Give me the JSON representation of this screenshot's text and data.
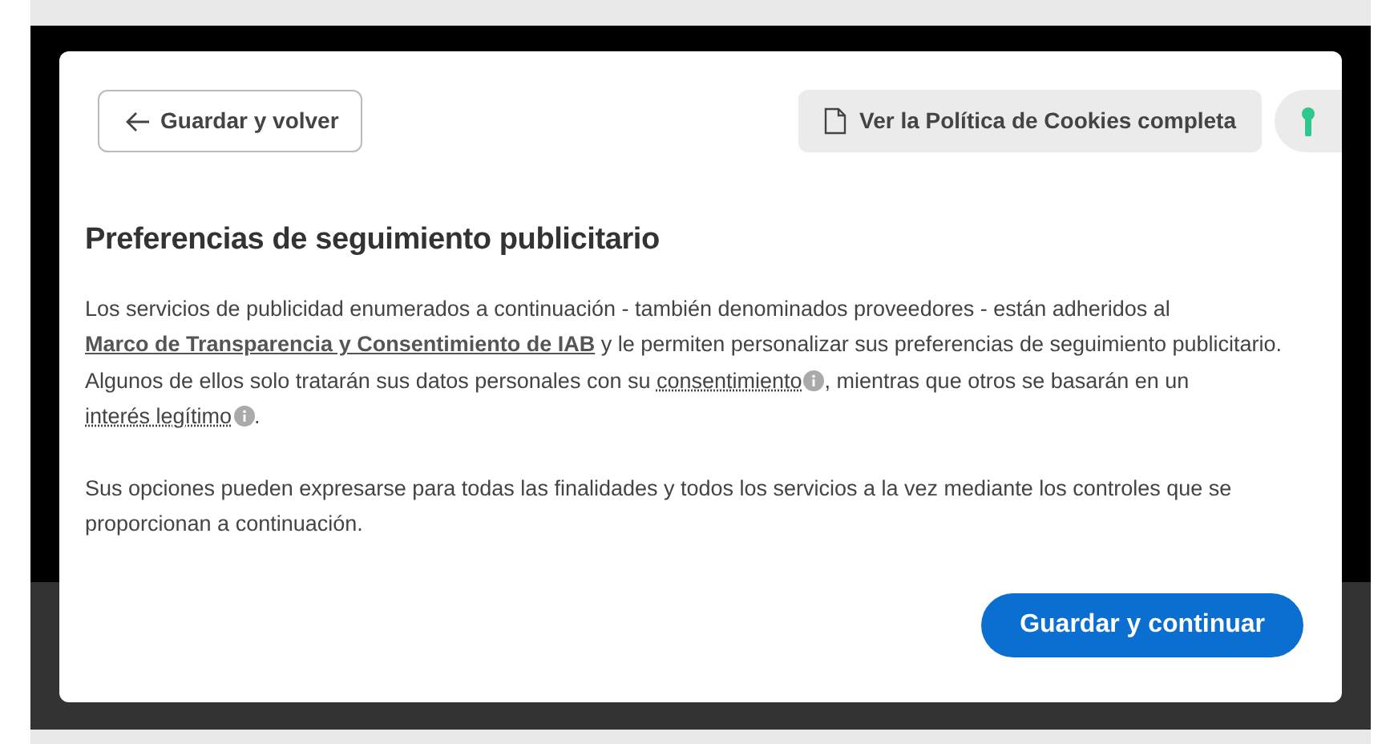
{
  "header": {
    "back_button": {
      "label": "Guardar y volver"
    },
    "policy_button": {
      "label": "Ver la Política de Cookies completa"
    }
  },
  "title": "Preferencias de seguimiento publicitario",
  "paragraphs": [
    [
      {
        "kind": "text",
        "text": "Los servicios de publicidad enumerados a continuación - también denominados proveedores - están adheridos al "
      },
      {
        "kind": "link",
        "text": "Marco de Transparencia y Consentimiento de IAB"
      },
      {
        "kind": "text",
        "text": " y le permiten personalizar sus preferencias de seguimiento publicitario. Algunos de ellos solo tratarán sus datos personales con su "
      },
      {
        "kind": "term",
        "text": "consentimiento"
      },
      {
        "kind": "text",
        "text": ", mientras que otros se basarán en un "
      },
      {
        "kind": "term",
        "text": "interés legítimo"
      },
      {
        "kind": "text",
        "text": "."
      }
    ],
    [
      {
        "kind": "text",
        "text": "Sus opciones pueden expresarse para todas las finalidades y todos los servicios a la vez mediante los controles que se proporcionan a continuación."
      }
    ]
  ],
  "footer": {
    "continue_button": {
      "label": "Guardar y continuar"
    }
  }
}
